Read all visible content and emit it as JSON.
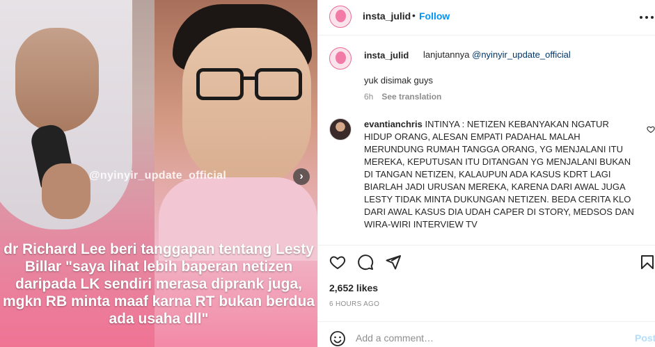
{
  "media": {
    "watermark": "@nyinyir_update_official",
    "caption": "dr Richard Lee beri tanggapan tentang Lesty Billar \"saya lihat lebih baperan netizen daripada LK sendiri merasa diprank juga, mgkn RB minta maaf karna RT bukan berdua ada usaha dll\"",
    "next_icon": "chevron-right-icon"
  },
  "header": {
    "username": "insta_julid",
    "separator": "•",
    "follow_label": "Follow",
    "more_icon": "more-horizontal-icon"
  },
  "comments": [
    {
      "username": "insta_julid",
      "text": "lanjutannya",
      "mention": "@nyinyir_update_official",
      "text2": "yuk disimak guys",
      "time": "6h",
      "translate": "See translation"
    },
    {
      "username": "evantianchris",
      "text": "INTINYA : NETIZEN KEBANYAKAN NGATUR HIDUP ORANG, ALESAN EMPATI PADAHAL MALAH MERUNDUNG RUMAH TANGGA ORANG, YG MENJALANI ITU MEREKA, KEPUTUSAN ITU DITANGAN YG MENJALANI BUKAN DI TANGAN NETIZEN, KALAUPUN ADA KASUS KDRT LAGI BIARLAH JADI URUSAN MEREKA, KARENA DARI AWAL JUGA LESTY TIDAK MINTA DUKUNGAN NETIZEN. BEDA CERITA KLO DARI AWAL KASUS DIA UDAH CAPER DI STORY, MEDSOS DAN WIRA-WIRI INTERVIEW TV",
      "like_icon": "heart-outline-icon"
    }
  ],
  "actions": {
    "icons": [
      "heart-icon",
      "comment-icon",
      "share-icon",
      "bookmark-icon"
    ],
    "likes": "2,652 likes",
    "time": "6 HOURS AGO"
  },
  "add_comment": {
    "placeholder": "Add a comment…",
    "post_label": "Post",
    "emoji_icon": "emoji-icon"
  }
}
